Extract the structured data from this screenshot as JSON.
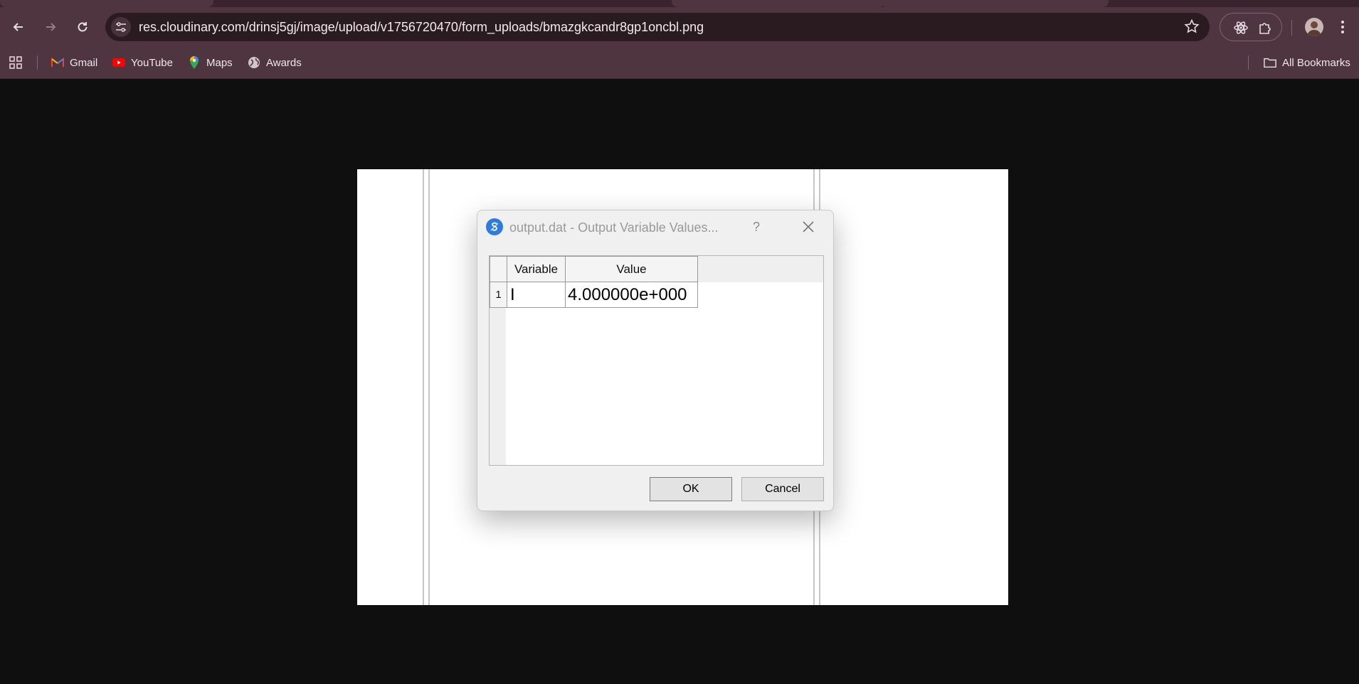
{
  "browser": {
    "url": "res.cloudinary.com/drinsj5gj/image/upload/v1756720470/form_uploads/bmazgkcandr8gp1oncbl.png",
    "bookmarks": [
      {
        "label": "Gmail",
        "icon": "gmail-icon"
      },
      {
        "label": "YouTube",
        "icon": "youtube-icon"
      },
      {
        "label": "Maps",
        "icon": "maps-icon"
      },
      {
        "label": "Awards",
        "icon": "globe-icon"
      }
    ],
    "all_bookmarks_label": "All Bookmarks"
  },
  "dialog": {
    "title": "output.dat - Output Variable Values...",
    "help_label": "?",
    "table": {
      "headers": [
        "Variable",
        "Value"
      ],
      "rows": [
        {
          "index": "1",
          "variable": "I",
          "value": "4.000000e+000"
        }
      ]
    },
    "ok_label": "OK",
    "cancel_label": "Cancel"
  },
  "colors": {
    "chrome_bg": "#4e3540",
    "omnibox_bg": "#2a1b21",
    "page_bg": "#0f0f0f",
    "app_icon": "#2d7be0"
  }
}
